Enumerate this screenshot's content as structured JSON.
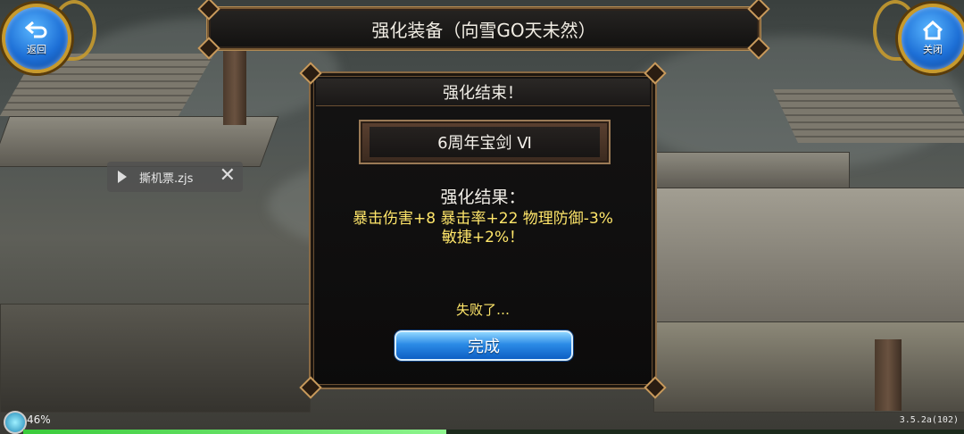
{
  "header": {
    "title": "强化装备（向雪GO天未然）",
    "back_label": "返回",
    "close_label": "关闭"
  },
  "toast": {
    "text": "撕机票.zjs"
  },
  "dialog": {
    "title": "强化结束！",
    "item_name": "6周年宝剑 Ⅵ",
    "result_title": "强化结果：",
    "result_line1": "暴击伤害+8  暴击率+22  物理防御-3%",
    "result_line2": "敏捷+2%！",
    "fail_text": "失败了…",
    "confirm_label": "完成"
  },
  "status": {
    "battery": "46%",
    "version": "3.5.2a(102)",
    "exp_progress_percent": 45
  },
  "colors": {
    "result_text": "#ffe66a",
    "button_blue": "#2b8be6",
    "frame_gold": "#c79a2d"
  }
}
